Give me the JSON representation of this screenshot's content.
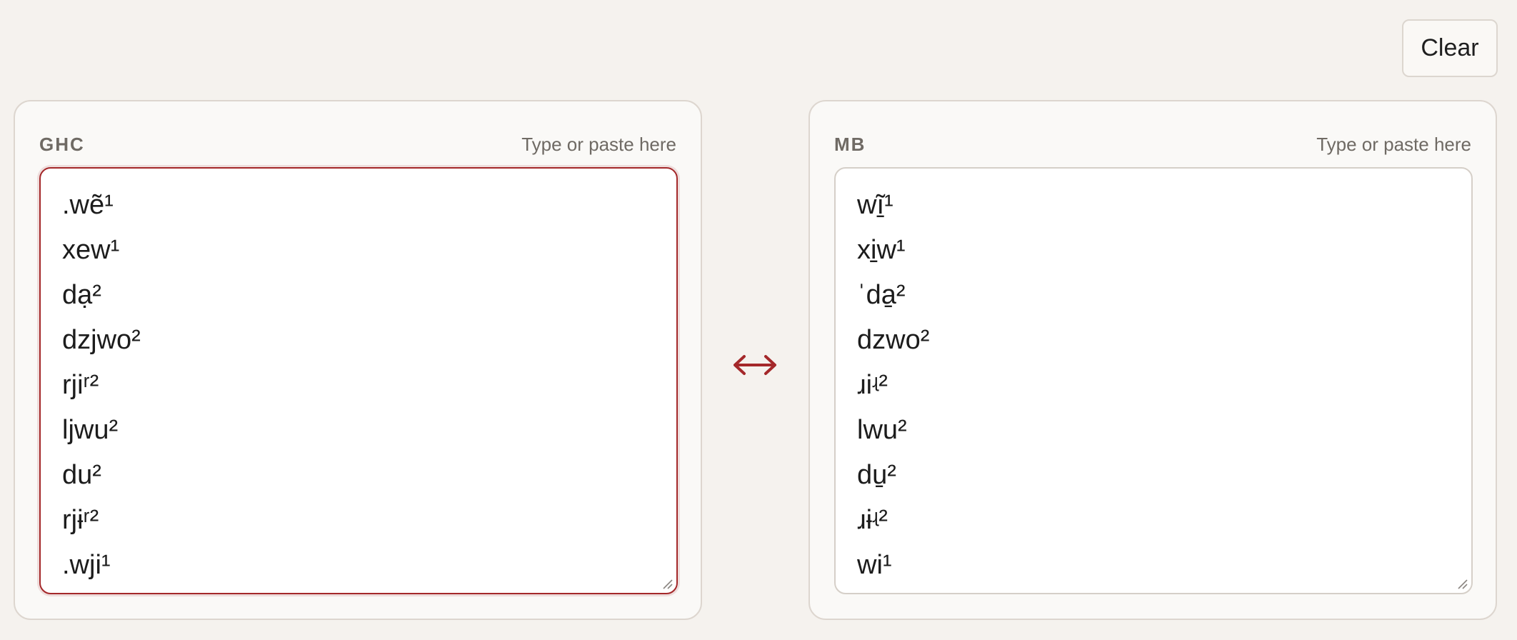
{
  "toolbar": {
    "clear_label": "Clear"
  },
  "colors": {
    "accent": "#a4282a",
    "background": "#f5f2ee",
    "panel": "#faf9f7"
  },
  "panels": {
    "left": {
      "label": "GHC",
      "hint": "Type or paste here",
      "lines": [
        ".wẽ¹",
        "xew¹",
        "dạ²",
        "dzjwo²",
        "rjiʳ²",
        "ljwu²",
        "du²",
        "rjɨʳ²",
        ".wji¹"
      ]
    },
    "right": {
      "label": "MB",
      "hint": "Type or paste here",
      "lines": [
        "wĩ̱¹",
        "xi̱w¹",
        "ˈda̱²",
        "dzwo²",
        "ɹiʵ²",
        "lwu²",
        "du̱²",
        "ɹɨʵ²",
        "wi¹"
      ]
    }
  },
  "swap": {
    "icon": "swap-arrows-icon"
  }
}
